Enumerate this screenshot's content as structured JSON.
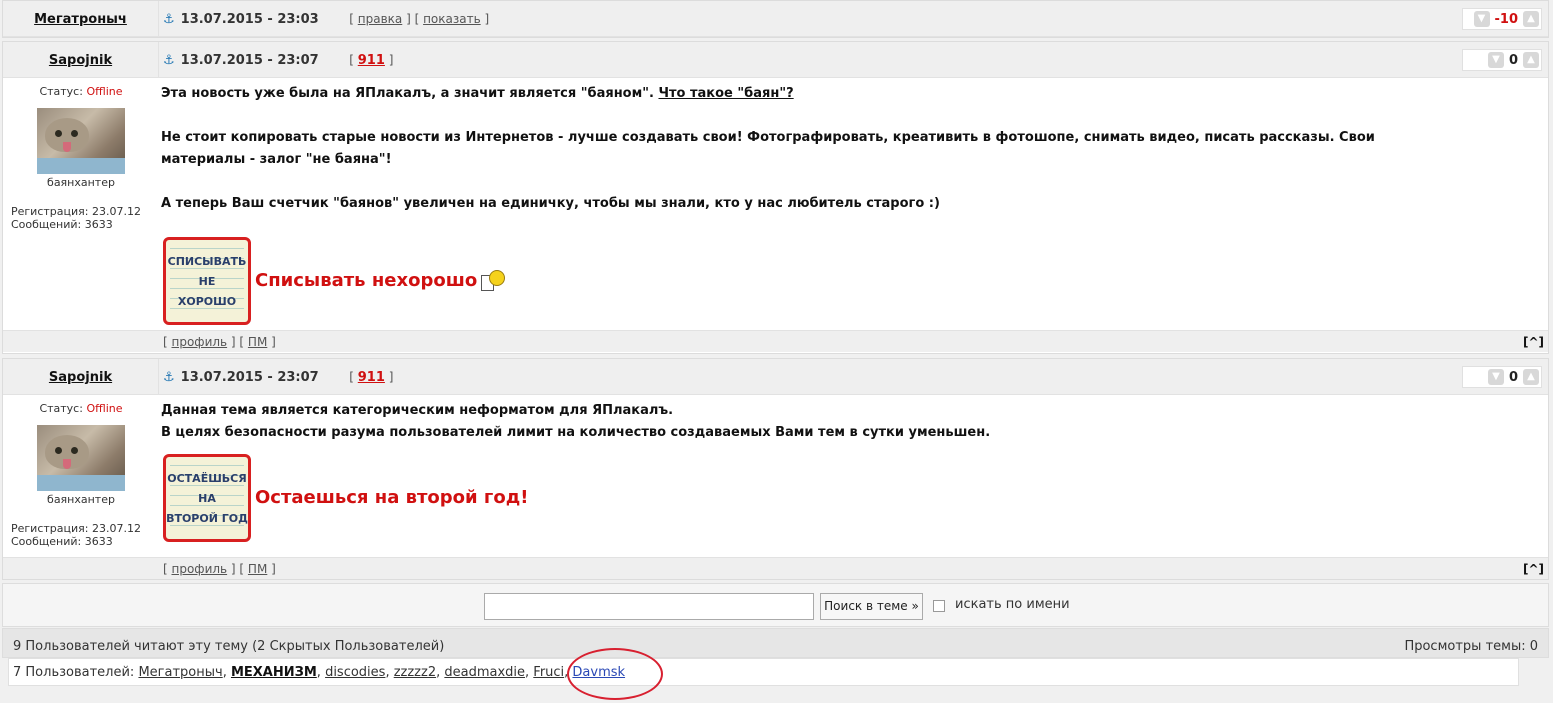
{
  "post0": {
    "author": "Мегатроныч",
    "datetime": "13.07.2015 - 23:03",
    "links": [
      "правка",
      "показать"
    ],
    "rating": "-10"
  },
  "post1": {
    "author": "Sapojnik",
    "datetime": "13.07.2015 - 23:07",
    "num": "911",
    "rating": "0",
    "status_label": "Статус:",
    "status_value": "Offline",
    "user_title": "баянхантер",
    "reg": "Регистрация: 23.07.12",
    "msgs": "Сообщений: 3633",
    "lines": [
      "Эта новость уже была на ЯПлакалъ, а значит является \"баяном\".",
      "Не стоит копировать старые новости из Интернетов - лучше создавать свои! Фотографировать, креативить в фотошопе, снимать видео, писать рассказы. Свои",
      "материалы - залог \"не баяна\"!",
      "А теперь Ваш счетчик \"баянов\" увеличен на единичку, чтобы мы знали, кто у нас любитель старого :)"
    ],
    "link_text": "Что такое \"баян\"?",
    "stamp": [
      "СПИСЫВАТЬ",
      "НЕ",
      "ХОРОШО"
    ],
    "caption": "Списывать нехорошо",
    "foot_links": [
      "профиль",
      "ПМ"
    ],
    "top": "[^]"
  },
  "post2": {
    "author": "Sapojnik",
    "datetime": "13.07.2015 - 23:07",
    "num": "911",
    "rating": "0",
    "status_label": "Статус:",
    "status_value": "Offline",
    "user_title": "баянхантер",
    "reg": "Регистрация: 23.07.12",
    "msgs": "Сообщений: 3633",
    "lines": [
      "Данная тема является категорическим неформатом для ЯПлакалъ.",
      "В целях безопасности разума пользователей лимит на количество создаваемых Вами тем в сутки уменьшен."
    ],
    "stamp": [
      "ОСТАЁШЬСЯ",
      "НА",
      "ВТОРОЙ ГОД"
    ],
    "caption": "Остаешься на второй год!",
    "foot_links": [
      "профиль",
      "ПМ"
    ],
    "top": "[^]"
  },
  "search": {
    "button": "Поиск в теме »",
    "checkbox_label": "искать по имени",
    "value": ""
  },
  "readers": {
    "left": "9 Пользователей читают эту тему (2 Скрытых Пользователей)",
    "right": "Просмотры темы: 0",
    "prefix": "7 Пользователей:",
    "users": [
      "Мегатроныч",
      "МЕХАНИЗМ",
      "discodies",
      "zzzzz2",
      "deadmaxdie",
      "Fruci",
      "Davmsk"
    ]
  },
  "colors": {
    "accent_red": "#d01010",
    "link_blue": "#2a48b5",
    "highlight_circle": "#d82030"
  }
}
